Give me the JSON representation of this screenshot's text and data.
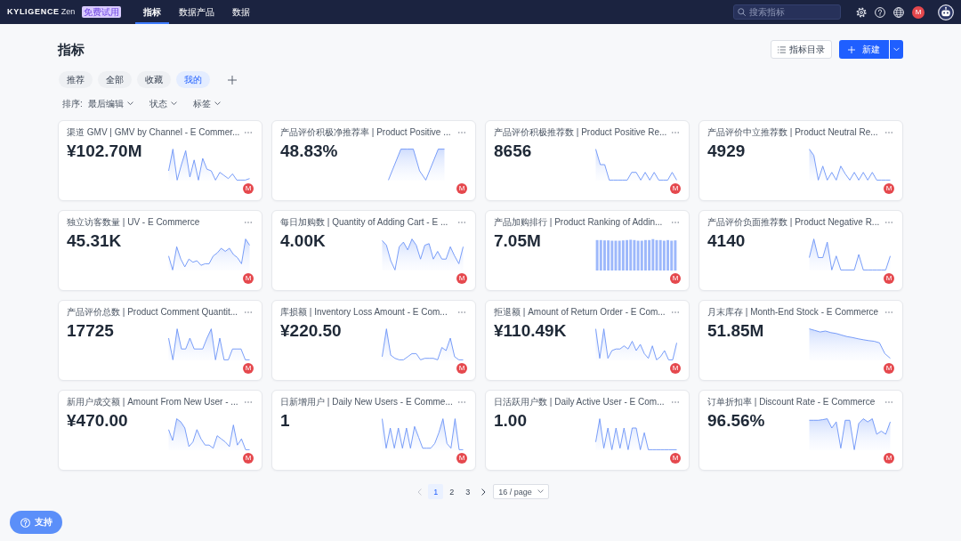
{
  "top_bar": {
    "logo": {
      "brand": "KYLIGENCE",
      "product": "Zen"
    },
    "badge": "免费试用",
    "nav": [
      {
        "label": "指标",
        "selected": true
      },
      {
        "label": "数据产品",
        "selected": false
      },
      {
        "label": "数据",
        "selected": false
      }
    ],
    "search": {
      "placeholder": "搜索指标"
    },
    "user_avatar": "M"
  },
  "header": {
    "title": "指标",
    "catalog_button": "指标目录",
    "new_button": "新建"
  },
  "tabs": [
    {
      "label": "推荐",
      "selected": false
    },
    {
      "label": "全部",
      "selected": false
    },
    {
      "label": "收藏",
      "selected": false
    },
    {
      "label": "我的",
      "selected": true
    }
  ],
  "filters": [
    {
      "label": "排序:",
      "value": "最后编辑"
    },
    {
      "value": "状态"
    },
    {
      "value": "标签"
    }
  ],
  "cards": [
    {
      "title": "渠道 GMV | GMV by Channel - E Commer...",
      "value": "¥102.70M",
      "kind": "line",
      "owner": "M"
    },
    {
      "title": "产品评价积极净推荐率 | Product Positive ...",
      "value": "48.83%",
      "kind": "line",
      "owner": "M"
    },
    {
      "title": "产品评价积极推荐数 | Product Positive Re...",
      "value": "8656",
      "kind": "line",
      "owner": "M"
    },
    {
      "title": "产品评价中立推荐数 | Product Neutral Re...",
      "value": "4929",
      "kind": "line",
      "owner": "M"
    },
    {
      "title": "独立访客数量 | UV - E Commerce",
      "value": "45.31K",
      "kind": "line",
      "owner": "M"
    },
    {
      "title": "每日加购数 | Quantity of Adding Cart - E ...",
      "value": "4.00K",
      "kind": "line",
      "owner": "M"
    },
    {
      "title": "产品加购排行 | Product Ranking of Addin...",
      "value": "7.05M",
      "kind": "bar",
      "owner": "M"
    },
    {
      "title": "产品评价负面推荐数 | Product Negative R...",
      "value": "4140",
      "kind": "line",
      "owner": "M"
    },
    {
      "title": "产品评价总数 | Product Comment Quantit...",
      "value": "17725",
      "kind": "line",
      "owner": "M"
    },
    {
      "title": "库损额 | Inventory Loss Amount - E Com...",
      "value": "¥220.50",
      "kind": "line",
      "owner": "M"
    },
    {
      "title": "拒退额 | Amount of Return Order - E Com...",
      "value": "¥110.49K",
      "kind": "line",
      "owner": "M"
    },
    {
      "title": "月末库存 | Month-End Stock - E Commerce",
      "value": "51.85M",
      "kind": "line",
      "owner": "M"
    },
    {
      "title": "新用户成交额 | Amount From New User - ...",
      "value": "¥470.00",
      "kind": "line",
      "owner": "M"
    },
    {
      "title": "日新增用户 | Daily New Users - E Comme...",
      "value": "1",
      "kind": "line",
      "owner": "M"
    },
    {
      "title": "日活跃用户数 | Daily Active User - E Com...",
      "value": "1.00",
      "kind": "line",
      "owner": "M"
    },
    {
      "title": "订单折扣率 | Discount Rate - E Commerce",
      "value": "96.56%",
      "kind": "line",
      "owner": "M"
    }
  ],
  "pagination": {
    "prev": {
      "disabled": true
    },
    "pages": [
      {
        "label": "1",
        "selected": true
      },
      {
        "label": "2",
        "selected": false
      },
      {
        "label": "3",
        "selected": false
      }
    ],
    "next": {
      "disabled": false
    },
    "page_size": "16 / page"
  },
  "support_button": "支持"
}
